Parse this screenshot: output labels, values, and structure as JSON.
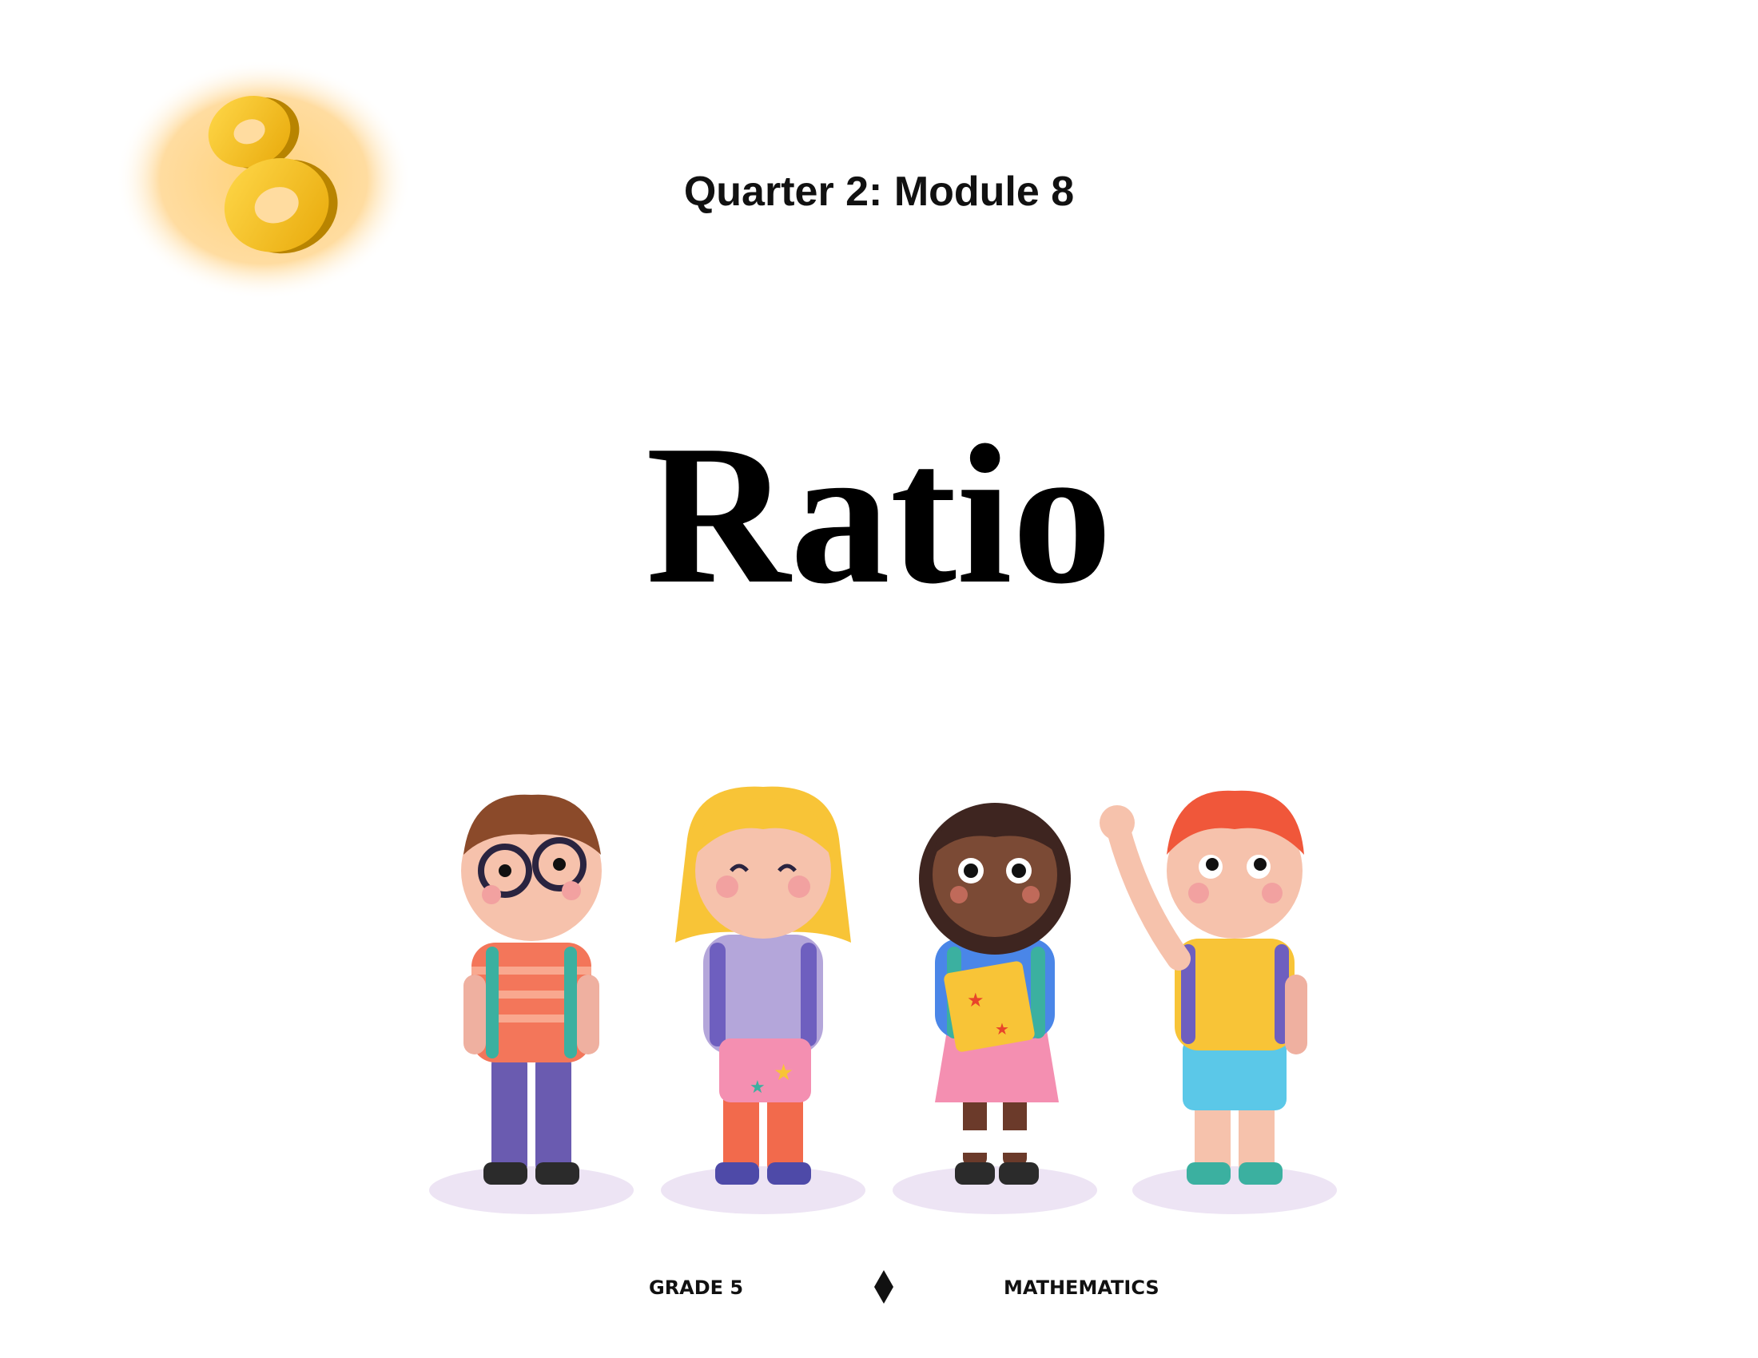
{
  "header": {
    "subtitle": "Quarter 2: Module 8"
  },
  "main": {
    "title": "Ratio"
  },
  "footer": {
    "left": "GRADE 5",
    "right": "MATHEMATICS",
    "separator_icon": "diamond-icon"
  },
  "badge": {
    "number": "8",
    "icon": "number-eight-badge-icon"
  },
  "illustration": {
    "name": "four-children-illustration"
  }
}
